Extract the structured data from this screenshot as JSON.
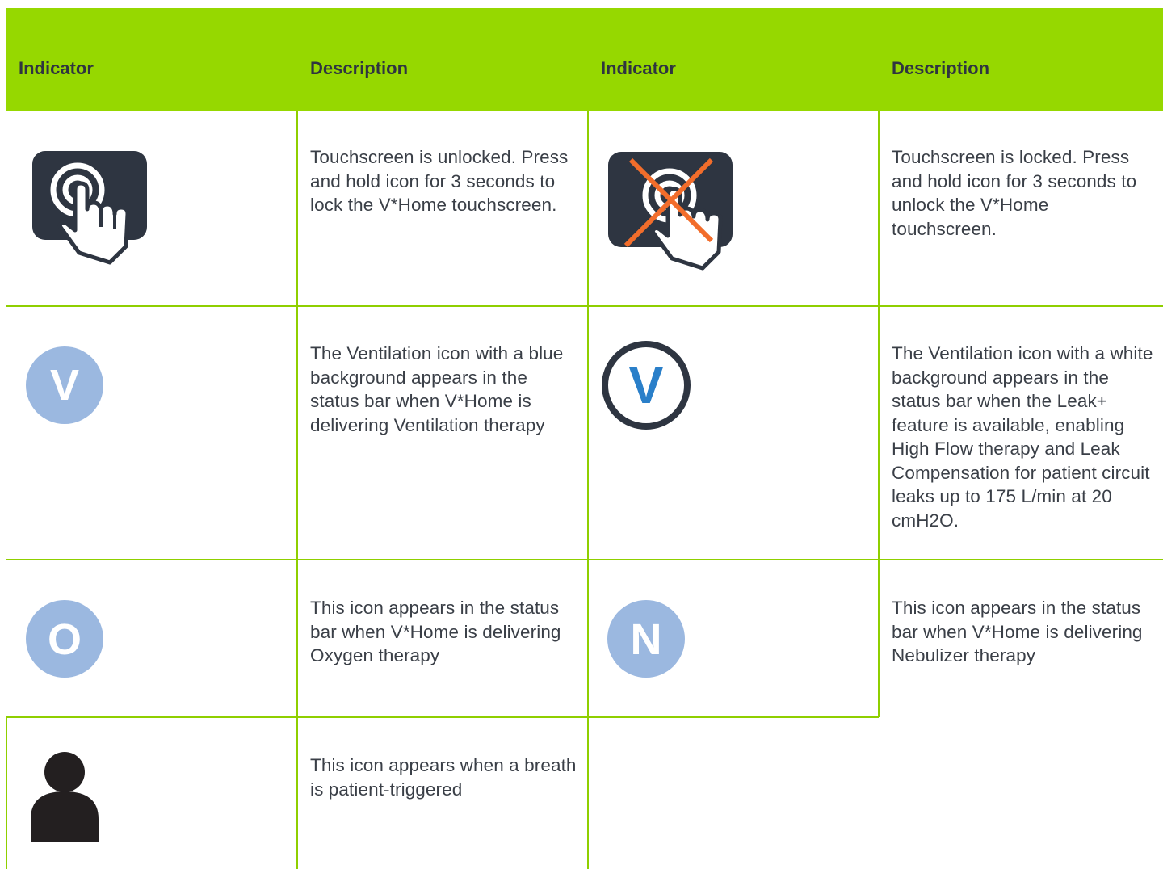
{
  "header": {
    "col1": "Indicator",
    "col2": "Description",
    "col3": "Indicator",
    "col4": "Description"
  },
  "colors": {
    "header_green": "#96d800",
    "grid_green": "#8fcf00",
    "icon_dark": "#2e3541",
    "icon_blue_light": "#9bb8e0",
    "icon_blue": "#2a7fc9",
    "lock_cross": "#f26d2b"
  },
  "rows": [
    {
      "left": {
        "icon": "touch-unlocked-icon",
        "text": "Touchscreen is unlocked. Press and hold icon for 3 seconds to lock the V*Home touchscreen."
      },
      "right": {
        "icon": "touch-locked-icon",
        "text": "Touchscreen is locked. Press and hold icon for 3 seconds to unlock the V*Home touchscreen."
      }
    },
    {
      "left": {
        "icon": "ventilation-blue-icon",
        "letter": "V",
        "text": "The Ventilation icon with a blue background appears in the status bar when V*Home is delivering Ventilation therapy"
      },
      "right": {
        "icon": "ventilation-white-icon",
        "letter": "V",
        "text": "The Ventilation icon with a white background appears in the status bar when the Leak+ feature is available, enabling High Flow therapy and Leak Compensation for patient circuit leaks up to 175 L/min at 20 cmH2O."
      }
    },
    {
      "left": {
        "icon": "oxygen-icon",
        "letter": "O",
        "text": "This icon appears in the status bar when V*Home is delivering Oxygen therapy"
      },
      "right": {
        "icon": "nebulizer-icon",
        "letter": "N",
        "text": "This icon appears in the status bar when V*Home is delivering Nebulizer therapy"
      }
    },
    {
      "left": {
        "icon": "patient-triggered-icon",
        "text": "This icon appears when a breath is patient-triggered"
      }
    }
  ]
}
